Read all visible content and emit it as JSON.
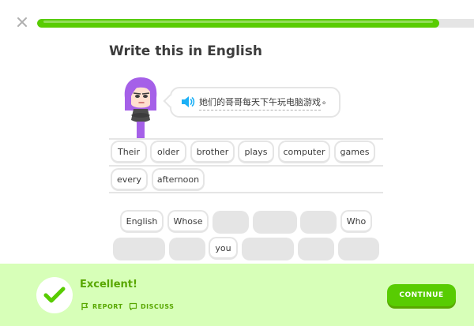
{
  "header": {
    "progress_percent": 92
  },
  "title": "Write this in English",
  "prompt": {
    "text": "她们的哥哥每天下午玩电脑游戏",
    "end_mark": "。"
  },
  "answer_tokens": [
    "Their",
    "older",
    "brother",
    "plays",
    "computer",
    "games",
    "every",
    "afternoon"
  ],
  "word_bank": {
    "row1": [
      "English",
      "Whose",
      "",
      "",
      "",
      "Who"
    ],
    "row2": [
      "",
      "",
      "you",
      "",
      "",
      ""
    ]
  },
  "feedback": {
    "title": "Excellent!",
    "report_label": "REPORT",
    "discuss_label": "DISCUSS",
    "continue_label": "CONTINUE"
  },
  "colors": {
    "accent": "#58cc02",
    "accent_dark": "#58a700",
    "footer_bg": "#d7ffb8"
  }
}
